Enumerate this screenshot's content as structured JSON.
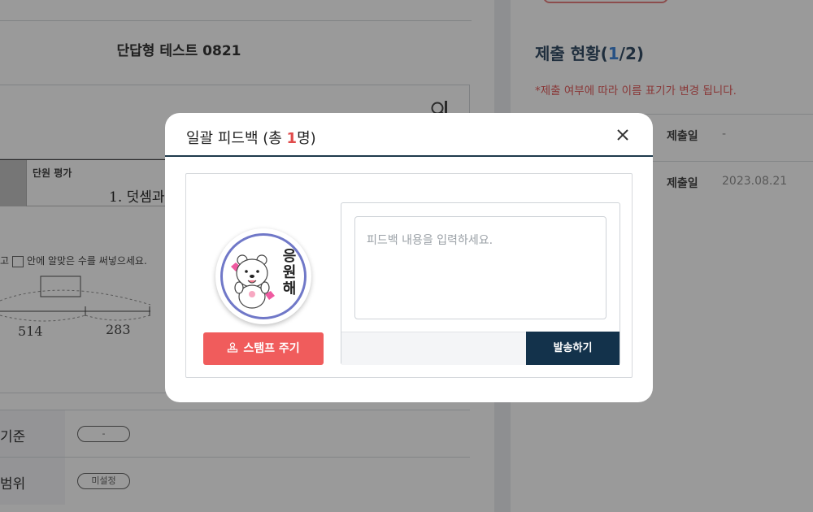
{
  "background": {
    "test_title": "단답형 테스트 0821",
    "unit_label": "단원 평가",
    "unit_name": "1. 덧셈과",
    "problem_text_before": "고",
    "problem_text_after": "안에 알맞은 수를 써넣으세요.",
    "diagram_numbers": [
      "514",
      "283"
    ],
    "rows": [
      {
        "label": "기준",
        "pill": "-"
      },
      {
        "label": "범위",
        "pill": "미설정"
      }
    ],
    "submission": {
      "title_prefix": "제출 현황(",
      "submitted": "1",
      "title_suffix": "/2)",
      "note": "*제출 여부에 따라 이름 표기가 변경 됩니다.",
      "rows": [
        {
          "key": "제출일",
          "value": "-"
        },
        {
          "key": "제출일",
          "value": "2023.08.21"
        }
      ]
    }
  },
  "modal": {
    "title_prefix": "일괄 피드백 (총 ",
    "count": "1",
    "title_suffix": "명)",
    "stamp_text": "응원해",
    "stamp_button_label": "스탬프 주기",
    "feedback_placeholder": "피드백 내용을 입력하세요.",
    "send_button_label": "발송하기",
    "icons": {
      "close": "close-icon",
      "stamp": "stamp-icon"
    }
  },
  "colors": {
    "accent_red": "#f05c5c",
    "navy": "#13324b",
    "stamp_ring": "#7078c8",
    "note_red": "#e04b4b",
    "count_blue": "#2f7ad8"
  }
}
